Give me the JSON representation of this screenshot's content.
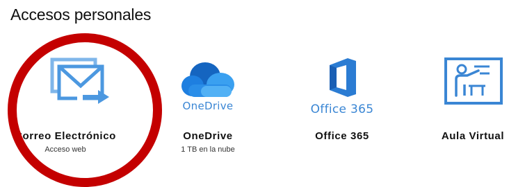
{
  "section": {
    "title": "Accesos personales"
  },
  "tiles": [
    {
      "icon": "mail-forward-icon",
      "title": "Correo Electrónico",
      "subtitle": "Acceso web"
    },
    {
      "icon": "onedrive-cloud-icon",
      "logo_text": "OneDrive",
      "title": "OneDrive",
      "subtitle": "1 TB en la nube"
    },
    {
      "icon": "office-365-logo-icon",
      "logo_text": "Office 365",
      "title": "Office 365"
    },
    {
      "icon": "teacher-board-icon",
      "title": "Aula Virtual"
    }
  ],
  "colors": {
    "accent_blue": "#3a86d4",
    "mail_blue": "#4c98e0",
    "office_orange_blue": "#1f73d6",
    "highlight_red": "#c40000"
  }
}
